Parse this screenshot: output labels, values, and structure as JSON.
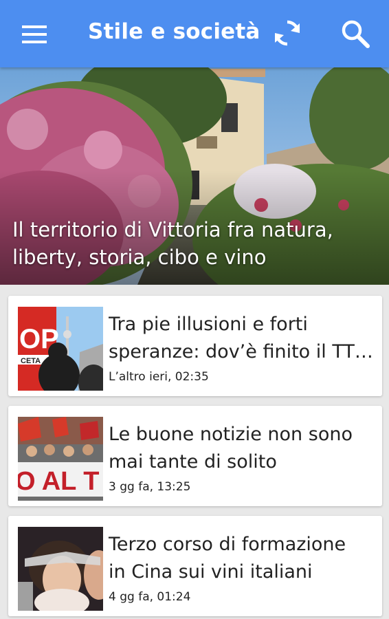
{
  "appbar": {
    "title": "Stile e società",
    "background": "#4d8ef0",
    "icons": [
      "menu-icon",
      "refresh-icon",
      "search-icon"
    ]
  },
  "hero": {
    "headline": "Il territorio di Vittoria fra natura, liberty, storia, cibo e vino"
  },
  "articles": [
    {
      "headline_line1": "Tra pie illusioni e forti",
      "headline_line2": "speranze: dov’è finito il TT…",
      "time": "L’altro ieri, 02:35",
      "thumb_text": "OP",
      "thumb_text2": "CETA"
    },
    {
      "headline_line1": "Le buone notizie non sono",
      "headline_line2": "mai tante di solito",
      "time": "3 gg fa, 13:25",
      "thumb_text": "O AL T"
    },
    {
      "headline_line1": "Terzo corso di formazione",
      "headline_line2": "in Cina sui vini italiani",
      "time": "4 gg fa, 01:24"
    }
  ]
}
